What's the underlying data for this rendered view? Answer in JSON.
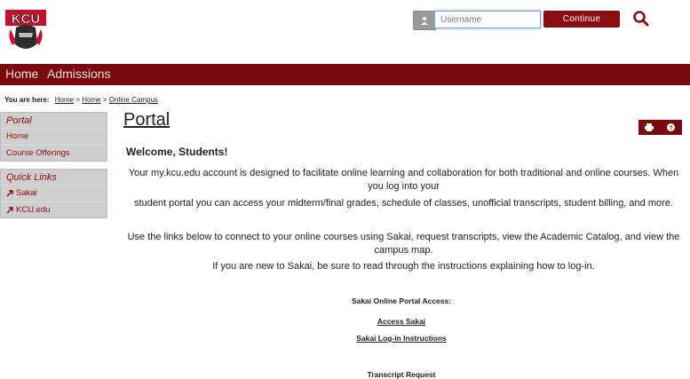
{
  "header": {
    "logo_text": "KCU",
    "username_placeholder": "Username",
    "continue_label": "Continue"
  },
  "nav": {
    "items": [
      "Home",
      "Admissions"
    ]
  },
  "breadcrumb": {
    "prefix": "You are here:",
    "links": [
      "Home",
      "Home",
      "Online Campus"
    ],
    "sep": ">"
  },
  "sidebar": {
    "portal": {
      "title": "Portal",
      "items": [
        "Home",
        "Course Offerings"
      ]
    },
    "quicklinks": {
      "title": "Quick Links",
      "items": [
        "Sakai",
        "KCU.edu"
      ]
    }
  },
  "main": {
    "title": "Portal",
    "welcome": "Welcome, Students!",
    "para1_line1": "Your my.kcu.edu account is designed to facilitate online learning and collaboration for both traditional and online courses. When you log into your",
    "para1_line2": "student portal you can access your midterm/final grades, schedule of classes, unofficial transcripts, student billing, and more.",
    "para2": "Use the links below to connect to your online courses using Sakai, request transcripts, view the Academic Catalog, and view the campus map.",
    "para3": "If you are new to Sakai, be sure to read through the instructions explaining how to log-in.",
    "portal_access_heading": "Sakai Online Portal Access:",
    "access_link": "Access Sakai",
    "instructions_link": "Sakai Log-in Instructions",
    "cutoff_heading": "Transcript Request"
  },
  "colors": {
    "brand": "#7b0a0d",
    "accent": "#8b0d12"
  }
}
